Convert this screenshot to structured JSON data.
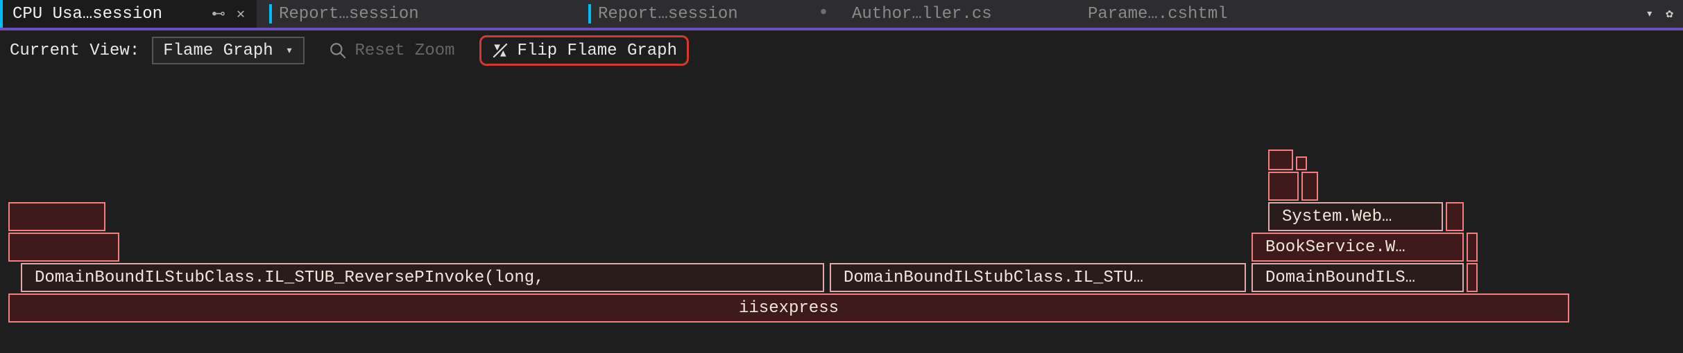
{
  "tabs": [
    {
      "label": "CPU Usa…session",
      "active": true,
      "pinned": true,
      "closeable": true,
      "dirty": false,
      "accent": false
    },
    {
      "label": "Report…session",
      "active": false,
      "pinned": false,
      "closeable": false,
      "dirty": false,
      "accent": true
    },
    {
      "label": "Report…session",
      "active": false,
      "pinned": false,
      "closeable": false,
      "dirty": true,
      "accent": true
    },
    {
      "label": "Author…ller.cs",
      "active": false,
      "pinned": false,
      "closeable": false,
      "dirty": false,
      "accent": false
    },
    {
      "label": "Parame….cshtml",
      "active": false,
      "pinned": false,
      "closeable": false,
      "dirty": false,
      "accent": false
    }
  ],
  "toolbar": {
    "current_view_label": "Current View:",
    "selected_view": "Flame Graph",
    "reset_zoom_label": "Reset Zoom",
    "flip_label": "Flip Flame Graph"
  },
  "flame": {
    "root": {
      "label": "iisexpress"
    },
    "row1": [
      {
        "label": "DomainBoundILStubClass.IL_STUB_ReversePInvoke(long,"
      },
      {
        "label": "DomainBoundILStubClass.IL_STU…"
      },
      {
        "label": "DomainBoundILS…"
      }
    ],
    "row2": [
      {
        "label": ""
      },
      {
        "label": "BookService.W…"
      }
    ],
    "row3": [
      {
        "label": ""
      },
      {
        "label": "System.Web…"
      }
    ],
    "row4": [
      {
        "label": ""
      },
      {
        "label": ""
      }
    ],
    "row5": [
      {
        "label": ""
      },
      {
        "label": ""
      }
    ]
  }
}
